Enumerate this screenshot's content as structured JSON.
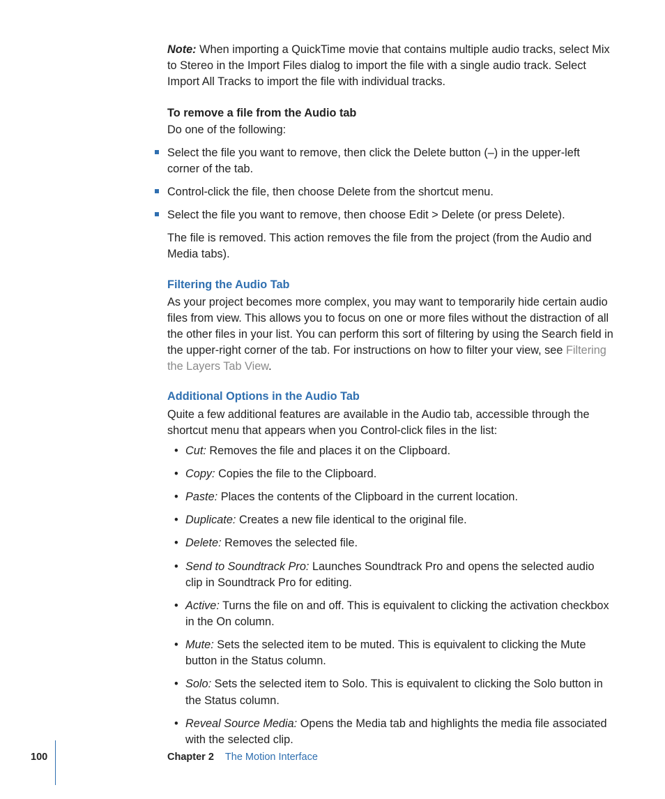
{
  "note": {
    "label": "Note:",
    "text": "When importing a QuickTime movie that contains multiple audio tracks, select Mix to Stereo in the Import Files dialog to import the file with a single audio track. Select Import All Tracks to import the file with individual tracks."
  },
  "remove": {
    "heading": "To remove a file from the Audio tab",
    "lead": "Do one of the following:",
    "items": [
      "Select the file you want to remove, then click the Delete button (–) in the upper-left corner of the tab.",
      "Control-click the file, then choose Delete from the shortcut menu.",
      "Select the file you want to remove, then choose Edit > Delete (or press Delete)."
    ],
    "after": "The file is removed. This action removes the file from the project (from the Audio and Media tabs)."
  },
  "filtering": {
    "heading": "Filtering the Audio Tab",
    "body_before_link": "As your project becomes more complex, you may want to temporarily hide certain audio files from view. This allows you to focus on one or more files without the distraction of all the other files in your list. You can perform this sort of filtering by using the Search field in the upper-right corner of the tab. For instructions on how to filter your view, see ",
    "link": "Filtering the Layers Tab View",
    "body_after_link": "."
  },
  "additional": {
    "heading": "Additional Options in the Audio Tab",
    "intro": "Quite a few additional features are available in the Audio tab, accessible through the shortcut menu that appears when you Control-click files in the list:",
    "options": [
      {
        "term": "Cut:",
        "desc": "Removes the file and places it on the Clipboard."
      },
      {
        "term": "Copy:",
        "desc": "Copies the file to the Clipboard."
      },
      {
        "term": "Paste:",
        "desc": "Places the contents of the Clipboard in the current location."
      },
      {
        "term": "Duplicate:",
        "desc": "Creates a new file identical to the original file."
      },
      {
        "term": "Delete:",
        "desc": "Removes the selected file."
      },
      {
        "term": "Send to Soundtrack Pro:",
        "desc": "Launches Soundtrack Pro and opens the selected audio clip in Soundtrack Pro for editing."
      },
      {
        "term": "Active:",
        "desc": "Turns the file on and off. This is equivalent to clicking the activation checkbox in the On column."
      },
      {
        "term": "Mute:",
        "desc": "Sets the selected item to be muted. This is equivalent to clicking the Mute button in the Status column."
      },
      {
        "term": "Solo:",
        "desc": "Sets the selected item to Solo. This is equivalent to clicking the Solo button in the Status column."
      },
      {
        "term": "Reveal Source Media:",
        "desc": "Opens the Media tab and highlights the media file associated with the selected clip."
      }
    ]
  },
  "footer": {
    "page": "100",
    "chapter": "Chapter 2",
    "title": "The Motion Interface"
  }
}
